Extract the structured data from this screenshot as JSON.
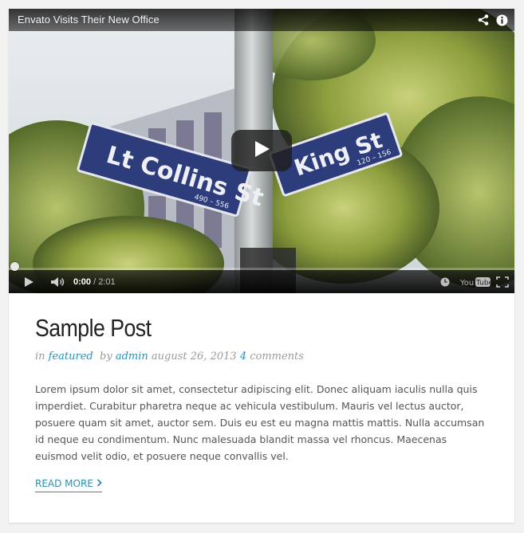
{
  "video": {
    "title": "Envato Visits Their New Office",
    "street_sign_left": "Lt Collins St",
    "street_sign_left_numbers": "490 – 556",
    "street_sign_right": "King St",
    "street_sign_right_numbers": "120 – 156",
    "time_current": "0:00",
    "time_separator": " / ",
    "time_total": "2:01",
    "progress_fraction": 0,
    "brand_label": "YouTube",
    "icons": {
      "share": "share-icon",
      "info": "info-icon",
      "play_overlay": "play-icon",
      "play_control": "play-icon",
      "volume": "volume-icon",
      "watch_later": "clock-icon",
      "youtube": "youtube-logo",
      "fullscreen": "fullscreen-icon"
    }
  },
  "post": {
    "title": "Sample Post",
    "meta": {
      "in_label": "in",
      "category": "featured",
      "by_label": "by",
      "author": "admin",
      "date": "august 26, 2013",
      "comments_count": "4",
      "comments_label": "comments"
    },
    "excerpt": "Lorem ipsum dolor sit amet, consectetur adipiscing elit. Donec aliquam iaculis nulla quis imperdiet. Curabitur pharetra neque ac vehicula vestibulum. Mauris vel lectus auctor, posuere quam sit amet, auctor sem. Duis eu est eu magna mattis mattis. Nulla accumsan id neque eu condimentum. Nunc malesuada blandit massa vel rhoncus. Maecenas euismod velit odio, et posuere neque convallis vel.",
    "read_more_label": "READ MORE",
    "read_more_icon": "chevron-right-icon"
  },
  "colors": {
    "accent": "#2a8fb5",
    "title": "#222222",
    "body_text": "#555555",
    "meta_text": "#9a9a9a",
    "sign_blue": "#2d3c7a"
  }
}
